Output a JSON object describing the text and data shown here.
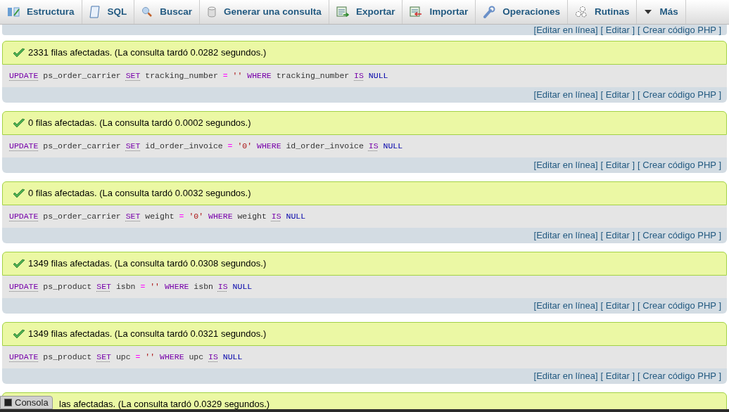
{
  "tabs": [
    {
      "label": "Estructura",
      "kind": "structure"
    },
    {
      "label": "SQL",
      "kind": "sql"
    },
    {
      "label": "Buscar",
      "kind": "search"
    },
    {
      "label": "Generar una consulta",
      "kind": "query"
    },
    {
      "label": "Exportar",
      "kind": "export"
    },
    {
      "label": "Importar",
      "kind": "import"
    },
    {
      "label": "Operaciones",
      "kind": "operations"
    },
    {
      "label": "Rutinas",
      "kind": "routines"
    },
    {
      "label": "Más",
      "kind": "more"
    }
  ],
  "top_links": [
    "[Editar en línea]",
    "[ Editar ]",
    "[ Crear código PHP ]"
  ],
  "results": [
    {
      "message": "2331 filas afectadas. (La consulta tardó 0.0282 segundos.)",
      "sql": [
        {
          "kind": "keyword",
          "text": "UPDATE"
        },
        {
          "kind": "plain",
          "text": "ps_order_carrier"
        },
        {
          "kind": "keyword",
          "text": "SET"
        },
        {
          "kind": "plain",
          "text": "tracking_number"
        },
        {
          "kind": "operator",
          "text": "="
        },
        {
          "kind": "string",
          "text": "''"
        },
        {
          "kind": "reserved",
          "text": "WHERE"
        },
        {
          "kind": "plain",
          "text": "tracking_number"
        },
        {
          "kind": "keyword",
          "text": "IS"
        },
        {
          "kind": "literal",
          "text": "NULL"
        }
      ],
      "links": [
        "[Editar en línea]",
        "[ Editar ]",
        "[ Crear código PHP ]"
      ]
    },
    {
      "message": "0 filas afectadas. (La consulta tardó 0.0002 segundos.)",
      "sql": [
        {
          "kind": "keyword",
          "text": "UPDATE"
        },
        {
          "kind": "plain",
          "text": "ps_order_carrier"
        },
        {
          "kind": "keyword",
          "text": "SET"
        },
        {
          "kind": "plain",
          "text": "id_order_invoice"
        },
        {
          "kind": "operator",
          "text": "="
        },
        {
          "kind": "string",
          "text": "'0'"
        },
        {
          "kind": "reserved",
          "text": "WHERE"
        },
        {
          "kind": "plain",
          "text": "id_order_invoice"
        },
        {
          "kind": "keyword",
          "text": "IS"
        },
        {
          "kind": "literal",
          "text": "NULL"
        }
      ],
      "links": [
        "[Editar en línea]",
        "[ Editar ]",
        "[ Crear código PHP ]"
      ]
    },
    {
      "message": "0 filas afectadas. (La consulta tardó 0.0032 segundos.)",
      "sql": [
        {
          "kind": "keyword",
          "text": "UPDATE"
        },
        {
          "kind": "plain",
          "text": "ps_order_carrier"
        },
        {
          "kind": "keyword",
          "text": "SET"
        },
        {
          "kind": "plain",
          "text": "weight"
        },
        {
          "kind": "operator",
          "text": "="
        },
        {
          "kind": "string",
          "text": "'0'"
        },
        {
          "kind": "reserved",
          "text": "WHERE"
        },
        {
          "kind": "plain",
          "text": "weight"
        },
        {
          "kind": "keyword",
          "text": "IS"
        },
        {
          "kind": "literal",
          "text": "NULL"
        }
      ],
      "links": [
        "[Editar en línea]",
        "[ Editar ]",
        "[ Crear código PHP ]"
      ]
    },
    {
      "message": "1349 filas afectadas. (La consulta tardó 0.0308 segundos.)",
      "sql": [
        {
          "kind": "keyword",
          "text": "UPDATE"
        },
        {
          "kind": "plain",
          "text": "ps_product"
        },
        {
          "kind": "keyword",
          "text": "SET"
        },
        {
          "kind": "plain",
          "text": "isbn"
        },
        {
          "kind": "operator",
          "text": "="
        },
        {
          "kind": "string",
          "text": "''"
        },
        {
          "kind": "reserved",
          "text": "WHERE"
        },
        {
          "kind": "plain",
          "text": "isbn"
        },
        {
          "kind": "keyword",
          "text": "IS"
        },
        {
          "kind": "literal",
          "text": "NULL"
        }
      ],
      "links": [
        "[Editar en línea]",
        "[ Editar ]",
        "[ Crear código PHP ]"
      ]
    },
    {
      "message": "1349 filas afectadas. (La consulta tardó 0.0321 segundos.)",
      "sql": [
        {
          "kind": "keyword",
          "text": "UPDATE"
        },
        {
          "kind": "plain",
          "text": "ps_product"
        },
        {
          "kind": "keyword",
          "text": "SET"
        },
        {
          "kind": "plain",
          "text": "upc"
        },
        {
          "kind": "operator",
          "text": "="
        },
        {
          "kind": "string",
          "text": "''"
        },
        {
          "kind": "reserved",
          "text": "WHERE"
        },
        {
          "kind": "plain",
          "text": "upc"
        },
        {
          "kind": "keyword",
          "text": "IS"
        },
        {
          "kind": "literal",
          "text": "NULL"
        }
      ],
      "links": [
        "[Editar en línea]",
        "[ Editar ]",
        "[ Crear código PHP ]"
      ]
    }
  ],
  "last_result": {
    "message": "las afectadas. (La consulta tardó 0.0329 segundos.)"
  },
  "console": {
    "label": "Consola"
  }
}
